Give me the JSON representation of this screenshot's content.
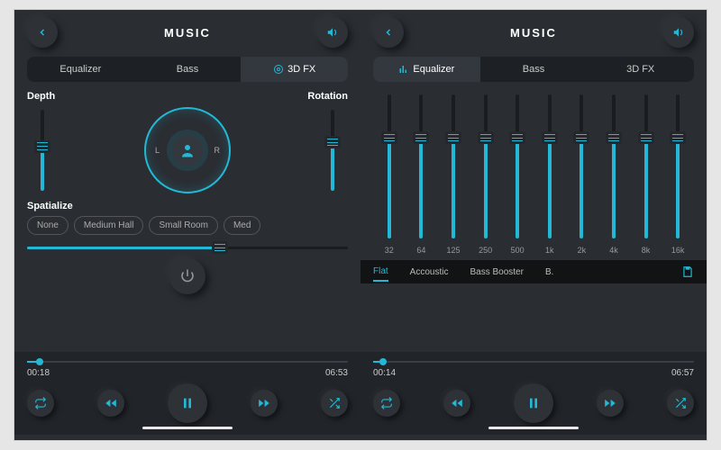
{
  "left": {
    "title": "MUSIC",
    "tabs": {
      "eq": "Equalizer",
      "bass": "Bass",
      "fx": "3D FX",
      "active": "fx"
    },
    "depth_label": "Depth",
    "rotation_label": "Rotation",
    "dial": {
      "left": "L",
      "right": "R"
    },
    "depth_pct": 55,
    "rotation_pct": 60,
    "spatialize_label": "Spatialize",
    "chips": [
      "None",
      "Medium Hall",
      "Small Room",
      "Med"
    ],
    "hslider_pct": 60,
    "play": {
      "elapsed": "00:18",
      "total": "06:53",
      "progress_pct": 4
    }
  },
  "right": {
    "title": "MUSIC",
    "tabs": {
      "eq": "Equalizer",
      "bass": "Bass",
      "fx": "3D FX",
      "active": "eq"
    },
    "bands_pct": [
      70,
      70,
      70,
      70,
      70,
      70,
      70,
      70,
      70,
      70
    ],
    "freqs": [
      "32",
      "64",
      "125",
      "250",
      "500",
      "1k",
      "2k",
      "4k",
      "8k",
      "16k"
    ],
    "presets": [
      "Flat",
      "Accoustic",
      "Bass Booster",
      "B."
    ],
    "preset_active": 0,
    "play": {
      "elapsed": "00:14",
      "total": "06:57",
      "progress_pct": 3
    }
  },
  "accent": "#22b8d6"
}
